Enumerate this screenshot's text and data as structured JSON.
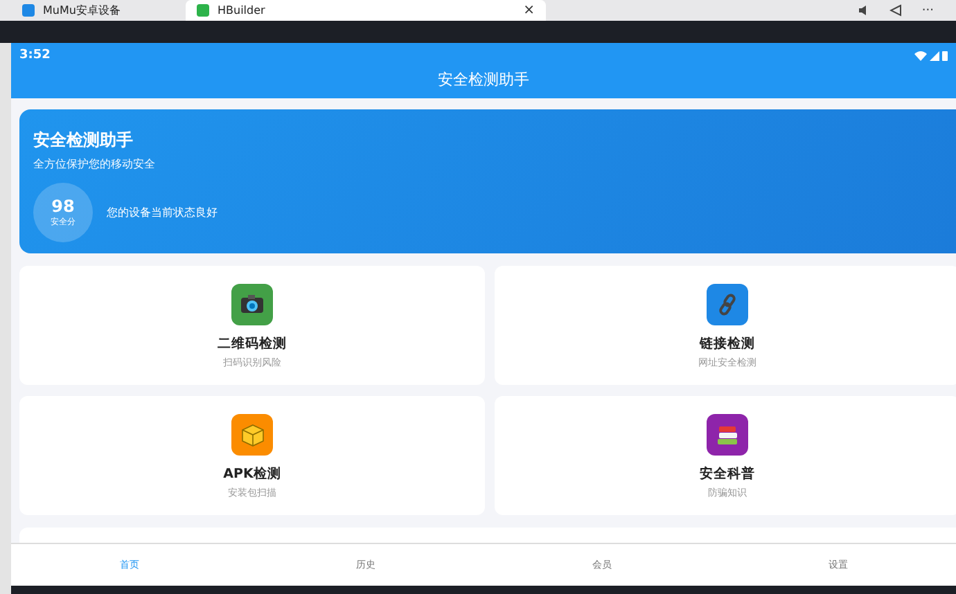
{
  "browser_tabs": [
    {
      "title": "MuMu安卓设备",
      "selected": false
    },
    {
      "title": "HBuilder",
      "selected": true,
      "close": "×"
    }
  ],
  "window_controls": {
    "more": "···"
  },
  "status_bar": {
    "time": "3:52"
  },
  "nav_title": "安全检测助手",
  "hero": {
    "title": "安全检测助手",
    "subtitle": "全方位保护您的移动安全",
    "score": "98",
    "score_label": "安全分",
    "status": "您的设备当前状态良好"
  },
  "features": [
    {
      "kind": "camera",
      "title": "二维码检测",
      "subtitle": "扫码识别风险",
      "color": "#43a047"
    },
    {
      "kind": "link",
      "title": "链接检测",
      "subtitle": "网址安全检测",
      "color": "#1e88e5"
    },
    {
      "kind": "box",
      "title": "APK检测",
      "subtitle": "安装包扫描",
      "color": "#fb8c00"
    },
    {
      "kind": "books",
      "title": "安全科普",
      "subtitle": "防骗知识",
      "color": "#8e24aa"
    }
  ],
  "tab_bar": [
    {
      "label": "首页",
      "selected": true
    },
    {
      "label": "历史",
      "selected": false
    },
    {
      "label": "会员",
      "selected": false
    },
    {
      "label": "设置",
      "selected": false
    }
  ]
}
